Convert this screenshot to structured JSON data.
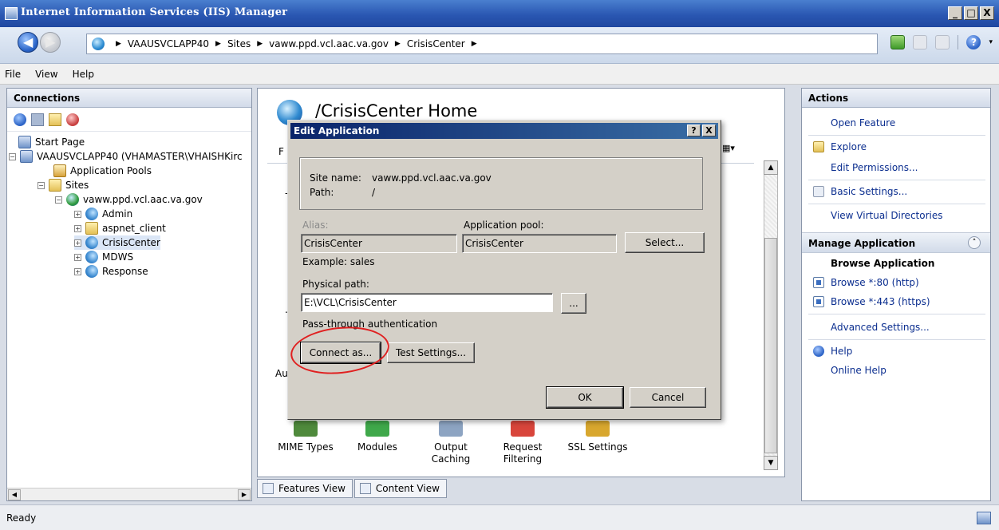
{
  "window": {
    "title": "Internet Information Services (IIS) Manager",
    "controls": [
      "_",
      "□",
      "X"
    ]
  },
  "navbar": {
    "breadcrumbs": [
      "VAAUSVCLAPP40",
      "Sites",
      "vaww.ppd.vcl.aac.va.gov",
      "CrisisCenter"
    ],
    "sep": "▶",
    "help_glyph": "?",
    "caret": "▾",
    "back_glyph": "◀",
    "fwd_glyph": "▶"
  },
  "menu": [
    "File",
    "View",
    "Help"
  ],
  "connections": {
    "header": "Connections",
    "tree": [
      {
        "label": "Start Page",
        "icon": "start-page-icon"
      },
      {
        "label": "VAAUSVCLAPP40 (VHAMASTER\\VHAISHKirc",
        "icon": "server-icon"
      },
      {
        "label": "Application Pools",
        "icon": "app-pools-icon"
      },
      {
        "label": "Sites",
        "icon": "sites-folder-icon"
      },
      {
        "label": "vaww.ppd.vcl.aac.va.gov",
        "icon": "website-globe-icon"
      },
      {
        "label": "Admin",
        "icon": "application-icon"
      },
      {
        "label": "aspnet_client",
        "icon": "folder-icon"
      },
      {
        "label": "CrisisCenter",
        "icon": "application-icon"
      },
      {
        "label": "MDWS",
        "icon": "application-icon"
      },
      {
        "label": "Response",
        "icon": "application-icon"
      }
    ],
    "expanders": {
      "collapsed": "+",
      "expanded": "−"
    }
  },
  "center": {
    "title": "/CrisisCenter Home",
    "partial_labels": {
      "f": "F",
      "au": "Au",
      "dash": "-",
      "dot": "."
    },
    "features": [
      {
        "label": "MIME Types",
        "color": "#4f8a3c"
      },
      {
        "label": "Modules",
        "color": "#3fa84a"
      },
      {
        "label": "Output Caching",
        "color": "#8da4c2"
      },
      {
        "label": "Request Filtering",
        "color": "#d8453b"
      },
      {
        "label": "SSL Settings",
        "color": "#d8a72e"
      }
    ],
    "tabs": [
      "Features View",
      "Content View"
    ]
  },
  "dialog": {
    "title": "Edit Application",
    "title_buttons": [
      "?",
      "X"
    ],
    "site_name_label": "Site name:",
    "site_name_value": "vaww.ppd.vcl.aac.va.gov",
    "path_label": "Path:",
    "path_value": "/",
    "alias_label": "Alias:",
    "alias_value": "CrisisCenter",
    "app_pool_label": "Application pool:",
    "app_pool_value": "CrisisCenter",
    "select_button": "Select...",
    "example_text": "Example: sales",
    "physical_path_label": "Physical path:",
    "physical_path_value": "E:\\VCL\\CrisisCenter",
    "browse_button": "...",
    "passthrough_label": "Pass-through authentication",
    "connect_as_button": "Connect as...",
    "test_settings_button": "Test Settings...",
    "ok_button": "OK",
    "cancel_button": "Cancel",
    "annotation_color": "#e02020"
  },
  "actions": {
    "header": "Actions",
    "items": {
      "open_feature": "Open Feature",
      "explore": "Explore",
      "edit_permissions": "Edit Permissions...",
      "basic_settings": "Basic Settings...",
      "view_virtual_directories": "View Virtual Directories",
      "manage_application": "Manage Application",
      "browse_application": "Browse Application",
      "browse_http": "Browse *:80 (http)",
      "browse_https": "Browse *:443 (https)",
      "advanced_settings": "Advanced Settings...",
      "help": "Help",
      "online_help": "Online Help"
    },
    "collapse_glyph": "˄"
  },
  "status": {
    "text": "Ready"
  },
  "colors": {
    "title_bar": "#2a57b2",
    "link": "#0b2e8f",
    "dialog_bg": "#d4d0c8"
  }
}
